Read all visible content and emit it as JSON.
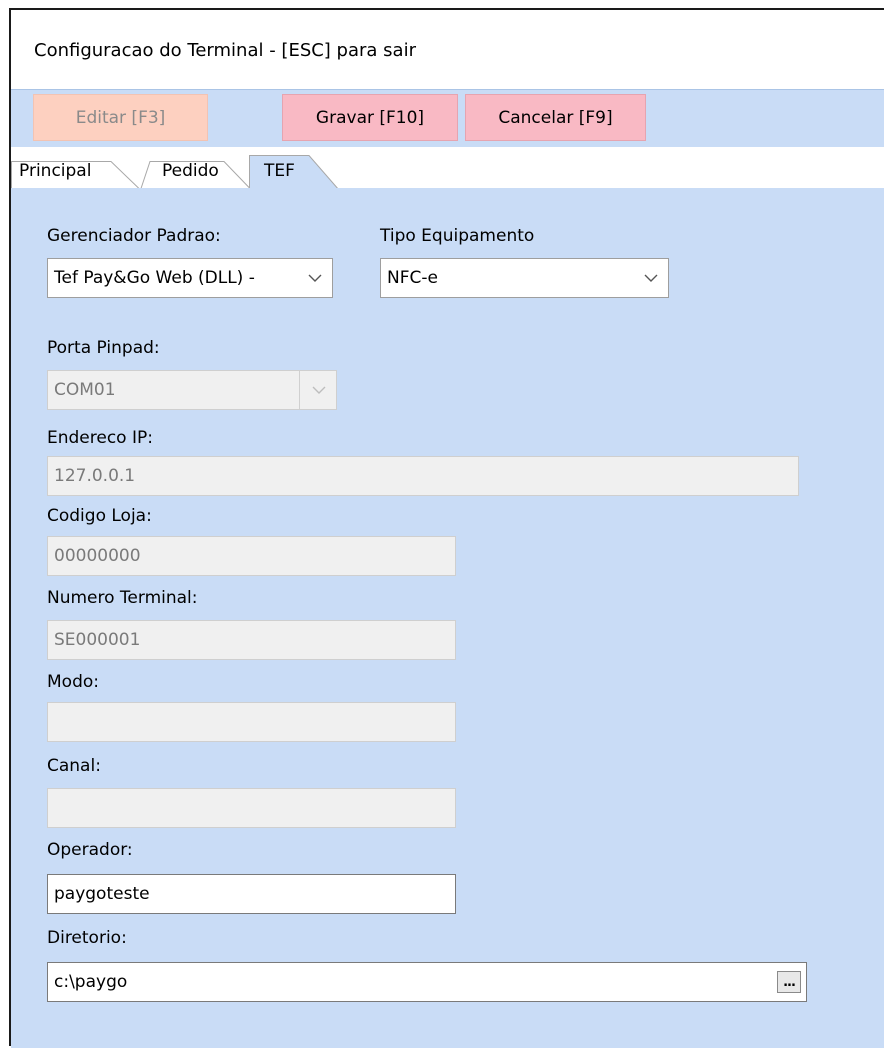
{
  "window": {
    "title": "Configuracao do Terminal - [ESC] para sair"
  },
  "toolbar": {
    "edit_label": "Editar [F3]",
    "save_label": "Gravar [F10]",
    "cancel_label": "Cancelar [F9]"
  },
  "tabs": [
    {
      "label": "Principal"
    },
    {
      "label": "Pedido"
    },
    {
      "label": "TEF",
      "selected": true
    }
  ],
  "form": {
    "gerenciador": {
      "label": "Gerenciador Padrao:",
      "value": "Tef Pay&Go Web (DLL) -"
    },
    "tipo_equipamento": {
      "label": "Tipo Equipamento",
      "value": "NFC-e"
    },
    "porta_pinpad": {
      "label": "Porta Pinpad:",
      "value": "COM01"
    },
    "endereco_ip": {
      "label": "Endereco IP:",
      "value": "127.0.0.1"
    },
    "codigo_loja": {
      "label": "Codigo Loja:",
      "value": "00000000"
    },
    "numero_terminal": {
      "label": "Numero Terminal:",
      "value": "SE000001"
    },
    "modo": {
      "label": "Modo:",
      "value": ""
    },
    "canal": {
      "label": "Canal:",
      "value": ""
    },
    "operador": {
      "label": "Operador:",
      "value": "paygoteste"
    },
    "diretorio": {
      "label": "Diretorio:",
      "value": "c:\\paygo",
      "browse_label": "..."
    }
  },
  "colors": {
    "content_bg": "#c9dcf6",
    "edit_button_bg": "#fdd0c0",
    "action_button_bg": "#f9b9c4",
    "disabled_field_bg": "#f0f0f0"
  },
  "icons": [
    "chevron-down-icon",
    "ellipsis-icon"
  ]
}
